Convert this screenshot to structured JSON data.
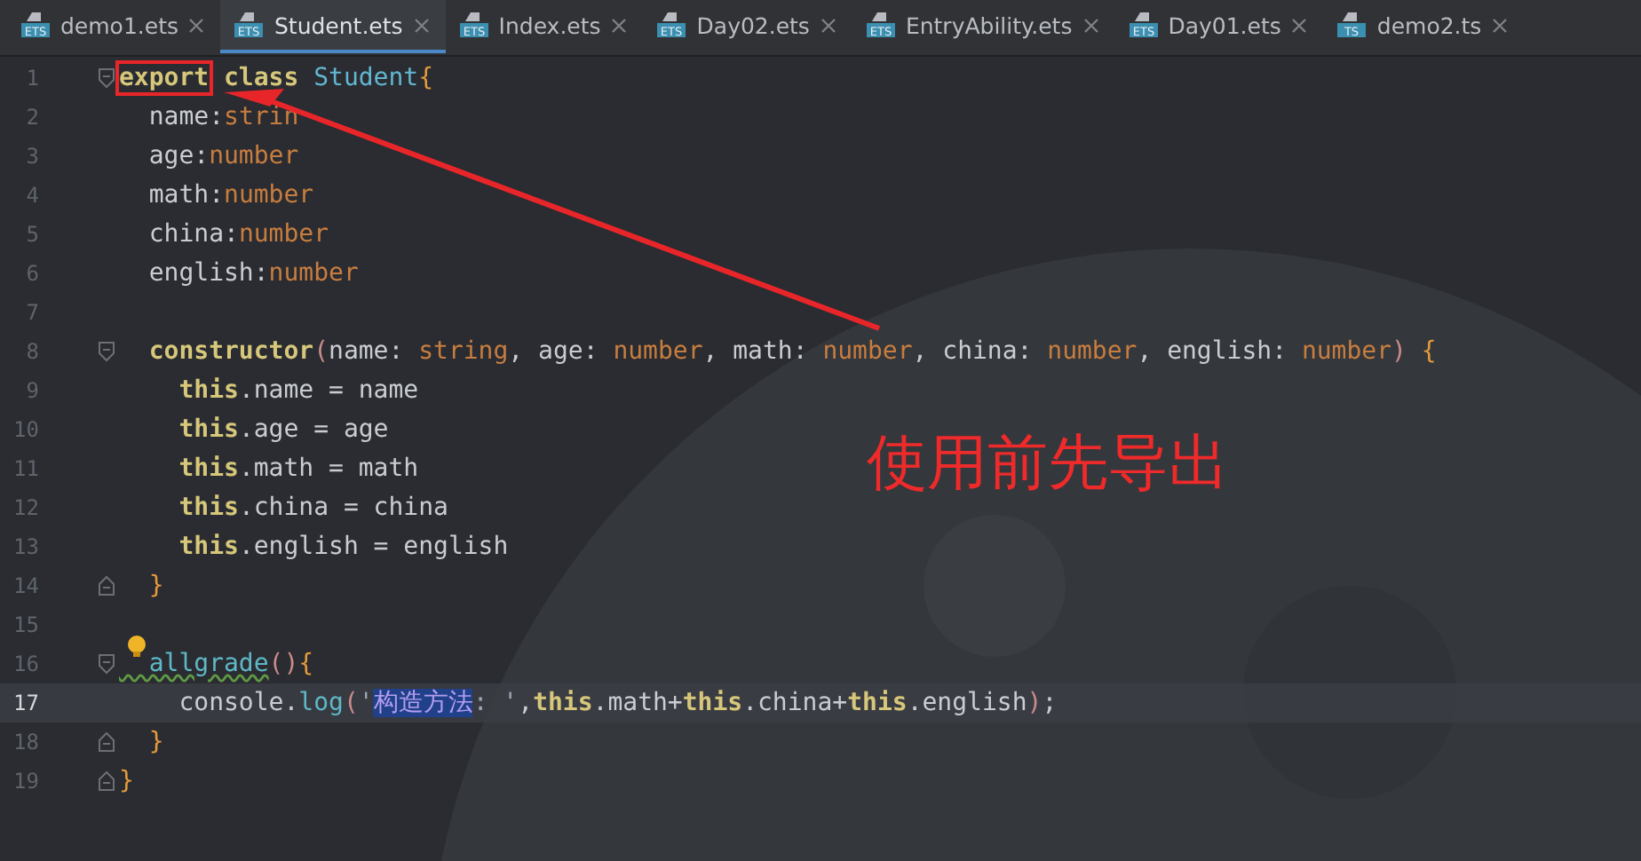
{
  "tabs": [
    {
      "label": "demo1.ets",
      "badge": "ETS",
      "selected": false
    },
    {
      "label": "Student.ets",
      "badge": "ETS",
      "selected": true
    },
    {
      "label": "Index.ets",
      "badge": "ETS",
      "selected": false
    },
    {
      "label": "Day02.ets",
      "badge": "ETS",
      "selected": false
    },
    {
      "label": "EntryAbility.ets",
      "badge": "ETS",
      "selected": false
    },
    {
      "label": "Day01.ets",
      "badge": "ETS",
      "selected": false
    },
    {
      "label": "demo2.ts",
      "badge": "TS",
      "selected": false
    }
  ],
  "code_lines": [
    {
      "number": "1",
      "kind": "start",
      "current": false,
      "bulb": false,
      "tokens": [
        {
          "kind": "keyword",
          "text": "export",
          "boxed": true
        },
        {
          "kind": "keyword",
          "text": " class"
        },
        {
          "kind": "classname",
          "text": " Student"
        },
        {
          "kind": "brace",
          "text": "{"
        }
      ]
    },
    {
      "number": "2",
      "kind": "plain",
      "current": false,
      "bulb": false,
      "tokens": [
        {
          "kind": "plain",
          "text": "  name:"
        },
        {
          "kind": "type",
          "text": "strin"
        }
      ]
    },
    {
      "number": "3",
      "kind": "plain",
      "current": false,
      "bulb": false,
      "tokens": [
        {
          "kind": "plain",
          "text": "  age:"
        },
        {
          "kind": "type",
          "text": "number"
        }
      ]
    },
    {
      "number": "4",
      "kind": "plain",
      "current": false,
      "bulb": false,
      "tokens": [
        {
          "kind": "plain",
          "text": "  math:"
        },
        {
          "kind": "type",
          "text": "number"
        }
      ]
    },
    {
      "number": "5",
      "kind": "plain",
      "current": false,
      "bulb": false,
      "tokens": [
        {
          "kind": "plain",
          "text": "  china:"
        },
        {
          "kind": "type",
          "text": "number"
        }
      ]
    },
    {
      "number": "6",
      "kind": "plain",
      "current": false,
      "bulb": false,
      "tokens": [
        {
          "kind": "plain",
          "text": "  english:"
        },
        {
          "kind": "type",
          "text": "number"
        }
      ]
    },
    {
      "number": "7",
      "kind": "plain",
      "current": false,
      "bulb": false
    },
    {
      "number": "8",
      "kind": "start",
      "current": false,
      "bulb": false,
      "tokens": [
        {
          "kind": "keyword",
          "text": "  constructor"
        },
        {
          "kind": "paren",
          "text": "("
        },
        {
          "kind": "plain",
          "text": "name: "
        },
        {
          "kind": "type",
          "text": "string"
        },
        {
          "kind": "plain",
          "text": ", age: "
        },
        {
          "kind": "type",
          "text": "number"
        },
        {
          "kind": "plain",
          "text": ", math: "
        },
        {
          "kind": "type",
          "text": "number"
        },
        {
          "kind": "plain",
          "text": ", china: "
        },
        {
          "kind": "type",
          "text": "number"
        },
        {
          "kind": "plain",
          "text": ", english: "
        },
        {
          "kind": "type",
          "text": "number"
        },
        {
          "kind": "paren",
          "text": ")"
        },
        {
          "kind": "brace",
          "text": " {"
        }
      ]
    },
    {
      "number": "9",
      "kind": "plain",
      "current": false,
      "bulb": false,
      "tokens": [
        {
          "kind": "keyword",
          "text": "    this"
        },
        {
          "kind": "plain",
          "text": ".name = name"
        }
      ]
    },
    {
      "number": "10",
      "kind": "plain",
      "current": false,
      "bulb": false,
      "tokens": [
        {
          "kind": "keyword",
          "text": "    this"
        },
        {
          "kind": "plain",
          "text": ".age = age"
        }
      ]
    },
    {
      "number": "11",
      "kind": "plain",
      "current": false,
      "bulb": false,
      "tokens": [
        {
          "kind": "keyword",
          "text": "    this"
        },
        {
          "kind": "plain",
          "text": ".math = math"
        }
      ]
    },
    {
      "number": "12",
      "kind": "plain",
      "current": false,
      "bulb": false,
      "tokens": [
        {
          "kind": "keyword",
          "text": "    this"
        },
        {
          "kind": "plain",
          "text": ".china = china"
        }
      ]
    },
    {
      "number": "13",
      "kind": "plain",
      "current": false,
      "bulb": false,
      "tokens": [
        {
          "kind": "keyword",
          "text": "    this"
        },
        {
          "kind": "plain",
          "text": ".english = english"
        }
      ]
    },
    {
      "number": "14",
      "kind": "end",
      "current": false,
      "bulb": false,
      "tokens": [
        {
          "kind": "brace",
          "text": "  }"
        }
      ]
    },
    {
      "number": "15",
      "kind": "plain",
      "current": false,
      "bulb": false
    },
    {
      "number": "16",
      "kind": "start",
      "current": false,
      "bulb": true,
      "tokens": [
        {
          "kind": "method",
          "text": "  allgrade"
        },
        {
          "kind": "paren",
          "text": "()"
        },
        {
          "kind": "brace",
          "text": "{"
        }
      ]
    },
    {
      "number": "17",
      "kind": "plain",
      "current": true,
      "bulb": false,
      "tokens": [
        {
          "kind": "plain",
          "text": "    console."
        },
        {
          "kind": "method",
          "text": "log"
        },
        {
          "kind": "paren",
          "text": "("
        },
        {
          "kind": "string",
          "text": "'"
        },
        {
          "kind": "selected",
          "text": "构造方法"
        },
        {
          "kind": "string",
          "text": ": '"
        },
        {
          "kind": "plain",
          "text": ","
        },
        {
          "kind": "keyword",
          "text": "this"
        },
        {
          "kind": "plain",
          "text": ".math+"
        },
        {
          "kind": "keyword",
          "text": "this"
        },
        {
          "kind": "plain",
          "text": ".china+"
        },
        {
          "kind": "keyword",
          "text": "this"
        },
        {
          "kind": "plain",
          "text": ".english"
        },
        {
          "kind": "paren",
          "text": ")"
        },
        {
          "kind": "plain",
          "text": ";"
        }
      ]
    },
    {
      "number": "18",
      "kind": "end",
      "current": false,
      "bulb": false,
      "tokens": [
        {
          "kind": "brace",
          "text": "  }"
        }
      ]
    },
    {
      "number": "19",
      "kind": "end",
      "current": false,
      "bulb": false,
      "tokens": [
        {
          "kind": "brace",
          "text": "}"
        }
      ]
    }
  ],
  "annotation": {
    "text": "使用前先导出"
  }
}
